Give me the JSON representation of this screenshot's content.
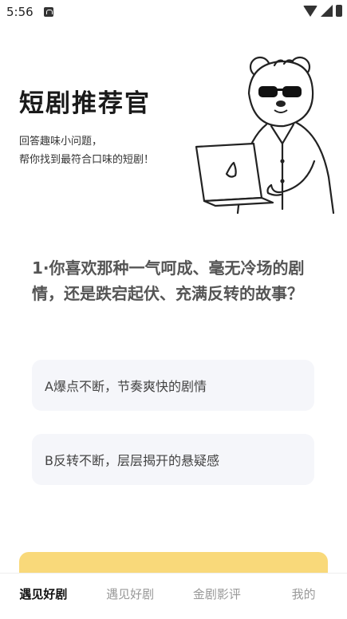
{
  "status_bar": {
    "time": "5:56",
    "icons": [
      "a-icon",
      "wifi-icon",
      "signal-icon",
      "battery-icon"
    ]
  },
  "hero": {
    "title": "短剧推荐官",
    "subtitle_lines": [
      "回答趣味小问题，",
      "帮你找到最符合口味的短剧！"
    ],
    "illustration": "bear-with-laptop-illustration"
  },
  "question": {
    "text": "1·你喜欢那种一气呵成、毫无冷场的剧情，还是跌宕起伏、充满反转的故事？"
  },
  "options": [
    {
      "label": "A爆点不断，节奏爽快的剧情"
    },
    {
      "label": "B反转不断，层层揭开的悬疑感"
    }
  ],
  "colors": {
    "accent": "#f9d97a",
    "option_bg": "#f5f6fa"
  },
  "bottom_nav": {
    "items": [
      {
        "label": "遇见好剧",
        "active": true
      },
      {
        "label": "遇见好剧",
        "active": false
      },
      {
        "label": "金剧影评",
        "active": false
      },
      {
        "label": "我的",
        "active": false
      }
    ]
  }
}
